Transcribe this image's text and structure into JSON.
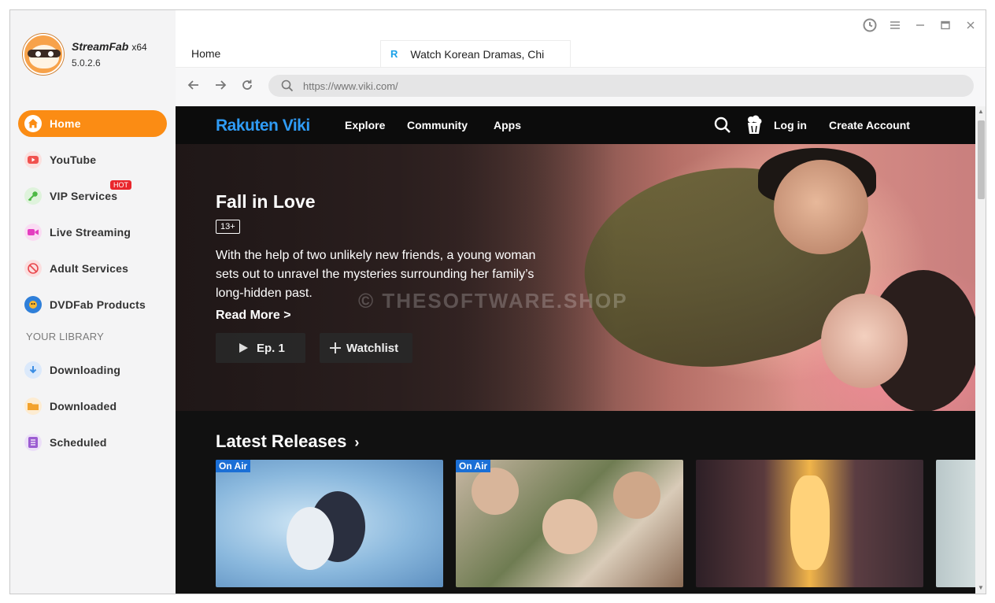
{
  "app": {
    "name": "StreamFab",
    "arch": "x64",
    "version": "5.0.2.6"
  },
  "sidebar": {
    "items": [
      {
        "label": "Home",
        "icon": "home-icon",
        "color": "#fb8c14",
        "active": true
      },
      {
        "label": "YouTube",
        "icon": "youtube-icon",
        "color": "#f0514e"
      },
      {
        "label": "VIP Services",
        "icon": "key-icon",
        "color": "#4cb944",
        "badge": "HOT"
      },
      {
        "label": "Live Streaming",
        "icon": "camera-icon",
        "color": "#e43ec0"
      },
      {
        "label": "Adult Services",
        "icon": "adult-icon",
        "color": "#e8474d"
      },
      {
        "label": "DVDFab Products",
        "icon": "dvdfab-icon",
        "color": "#2f7fd9"
      }
    ],
    "library_heading": "YOUR LIBRARY",
    "library": [
      {
        "label": "Downloading",
        "icon": "download-icon",
        "color": "#3b8de3"
      },
      {
        "label": "Downloaded",
        "icon": "folder-icon",
        "color": "#f3a22c"
      },
      {
        "label": "Scheduled",
        "icon": "list-icon",
        "color": "#9b5cd1"
      }
    ]
  },
  "tabs": {
    "home": "Home",
    "active_icon": "R",
    "active": "Watch Korean Dramas, Chi"
  },
  "address": {
    "placeholder": "https://www.viki.com/"
  },
  "viki": {
    "logo_main": "Rakuten ",
    "logo_accent": "Viki",
    "nav": [
      "Explore",
      "Community",
      "Apps"
    ],
    "login": "Log in",
    "create_account": "Create Account",
    "hero": {
      "title": "Fall in Love",
      "rating": "13+",
      "description": "With the help of two unlikely new friends, a young woman sets out to unravel the mysteries surrounding her family’s long-hidden past.",
      "read_more": "Read More >",
      "play_label": "Ep. 1",
      "watchlist_label": "Watchlist",
      "watermark": "© THESOFTWARE.SHOP"
    },
    "latest": {
      "title": "Latest Releases",
      "arrow": "›",
      "cards": [
        {
          "badge": "On Air"
        },
        {
          "badge": "On Air"
        },
        {
          "badge": ""
        },
        {
          "badge": ""
        }
      ]
    }
  }
}
